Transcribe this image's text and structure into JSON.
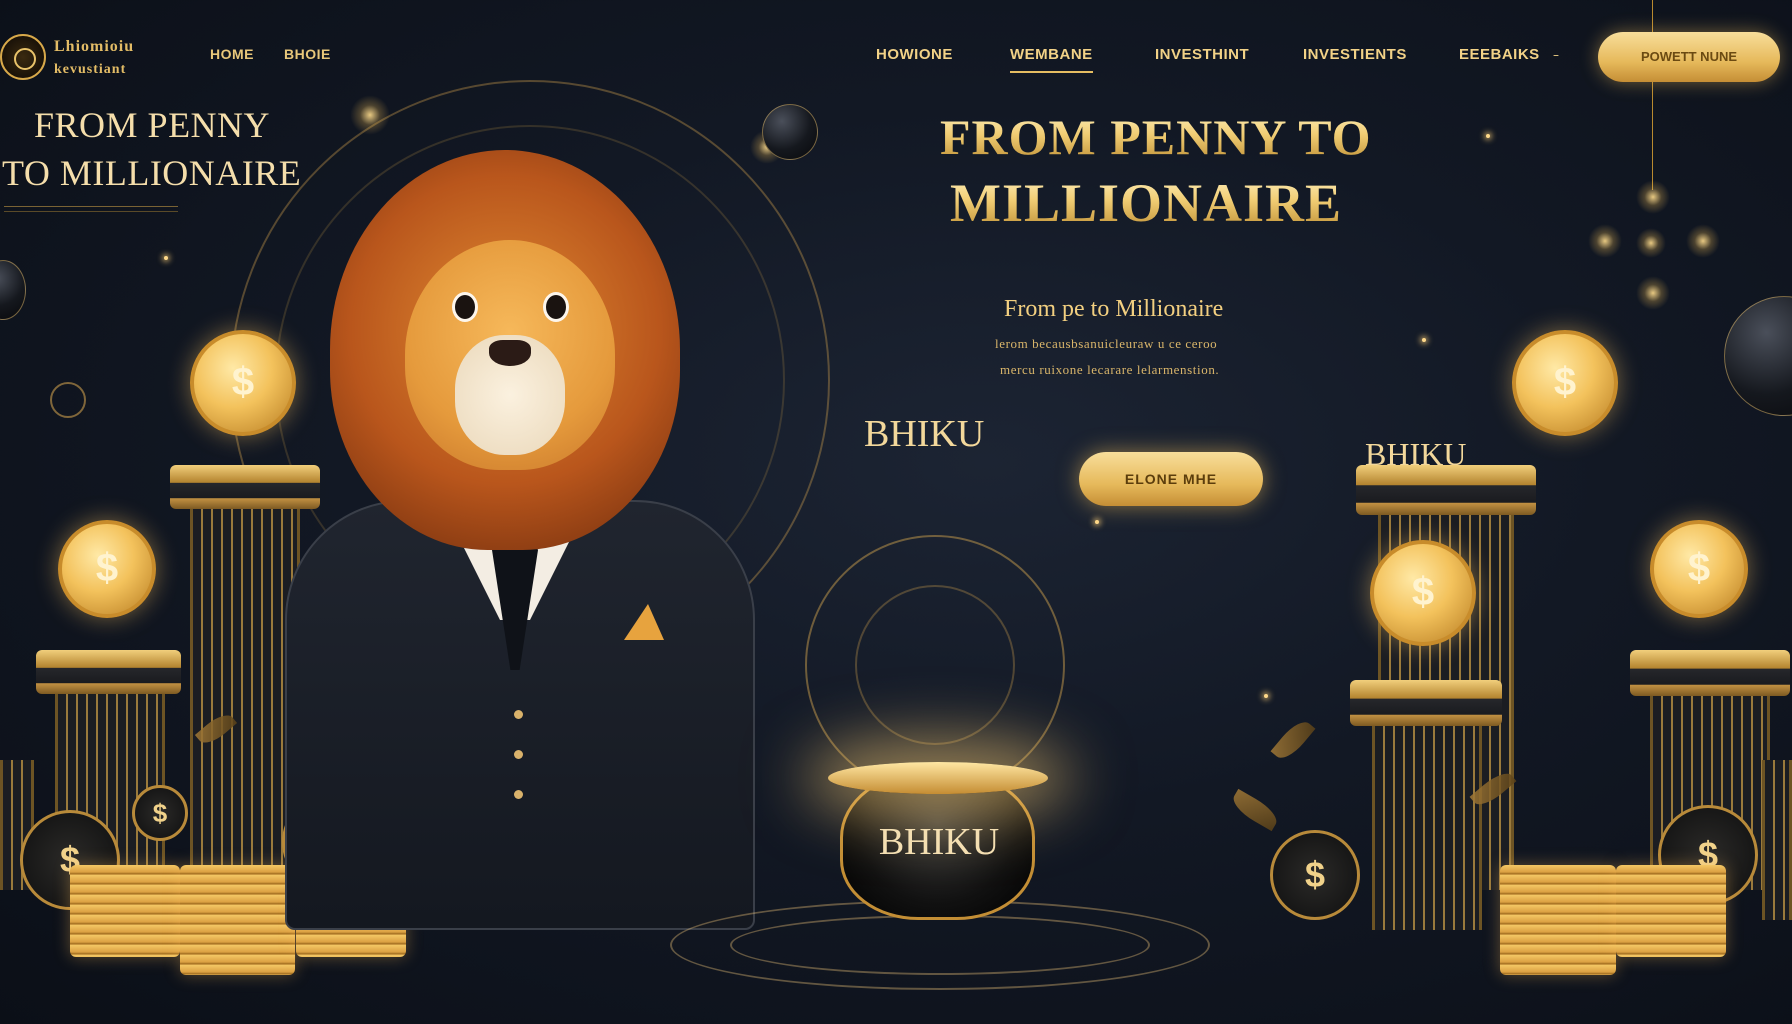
{
  "brand": {
    "name_line1": "Lhiomioiu",
    "name_line2": "kevustiant"
  },
  "nav_left": [
    "HOME",
    "BHOIE"
  ],
  "nav_main": {
    "items": [
      "HOWIONE",
      "WEMBANE",
      "INVESTHINT",
      "INVESTIENTS",
      "EEEBAIKS"
    ],
    "active": "WEMBANE"
  },
  "header_button": "POWETT NUNE",
  "left_headline": {
    "line1": "FROM PENNY",
    "line2": "TO MILLIONAIRE"
  },
  "hero": {
    "title_line1": "FROM PENNY TO",
    "title_line2": "MILLIONAIRE",
    "subtitle": "From pe   to Millionaire",
    "body_line1": "lerom becausbsanuicleuraw u ce ceroo",
    "body_line2": "mercu ruixone lecarare lelarmenstion.",
    "button": "ELONE MHE"
  },
  "labels": {
    "bhiku_center": "BHIKU",
    "bhiku_right": "BHIKU",
    "pot": "BHIKU"
  },
  "icons": {
    "coin_symbol": "$"
  },
  "colors": {
    "gold": "#e6b95b",
    "background": "#121824"
  }
}
